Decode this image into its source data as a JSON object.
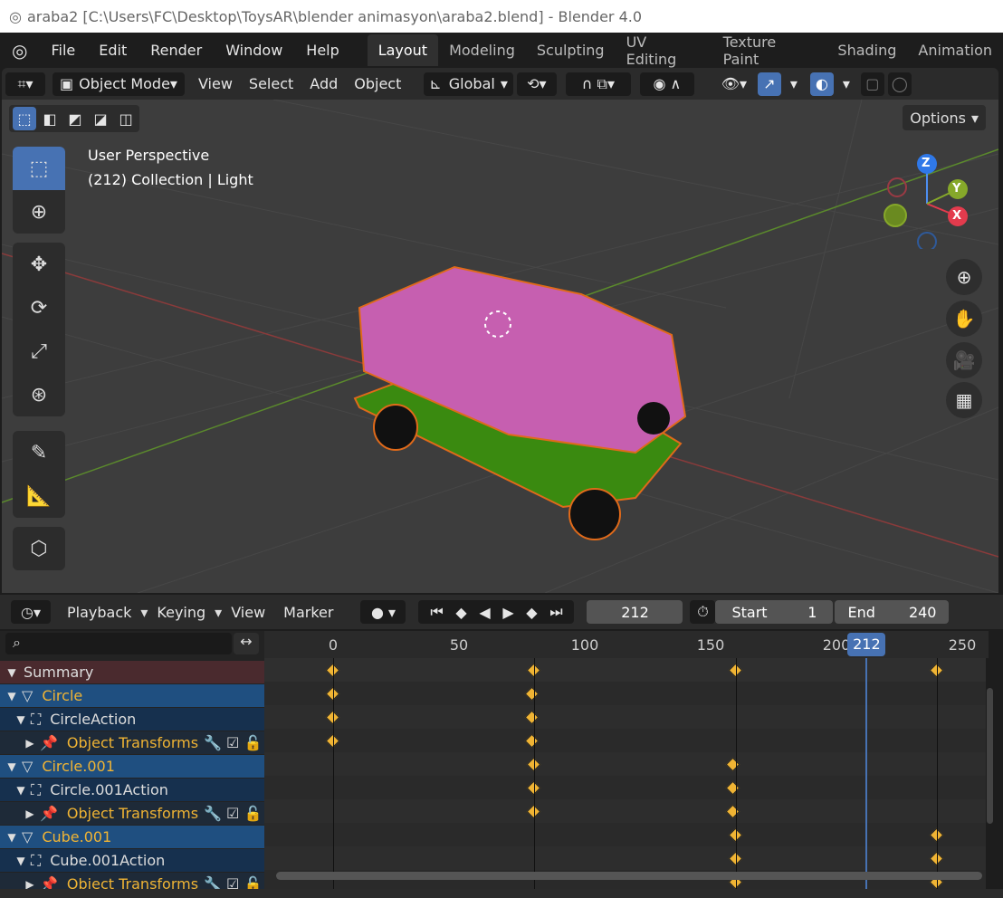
{
  "window": {
    "title": "araba2 [C:\\Users\\FC\\Desktop\\ToysAR\\blender animasyon\\araba2.blend] - Blender 4.0"
  },
  "menu": {
    "file": "File",
    "edit": "Edit",
    "render": "Render",
    "window": "Window",
    "help": "Help"
  },
  "workspaces": [
    "Layout",
    "Modeling",
    "Sculpting",
    "UV Editing",
    "Texture Paint",
    "Shading",
    "Animation"
  ],
  "viewport_header": {
    "mode": "Object Mode",
    "view": "View",
    "select": "Select",
    "add": "Add",
    "object": "Object",
    "orientation": "Global",
    "options": "Options"
  },
  "viewport": {
    "perspective": "User Perspective",
    "collection": "(212) Collection | Light"
  },
  "gizmo": {
    "z": "Z",
    "y": "Y",
    "x": "X"
  },
  "timeline_header": {
    "playback": "Playback",
    "keying": "Keying",
    "view": "View",
    "marker": "Marker",
    "current_frame": "212",
    "start_label": "Start",
    "start_value": "1",
    "end_label": "End",
    "end_value": "240"
  },
  "ruler": {
    "ticks": [
      "0",
      "50",
      "100",
      "150",
      "200",
      "250"
    ],
    "current": "212"
  },
  "channels": [
    {
      "label": "Summary",
      "type": "summary"
    },
    {
      "label": "Circle",
      "type": "object"
    },
    {
      "label": "CircleAction",
      "type": "action"
    },
    {
      "label": "Object Transforms",
      "type": "group"
    },
    {
      "label": "Circle.001",
      "type": "object"
    },
    {
      "label": "Circle.001Action",
      "type": "action"
    },
    {
      "label": "Object Transforms",
      "type": "group"
    },
    {
      "label": "Cube.001",
      "type": "object"
    },
    {
      "label": "Cube.001Action",
      "type": "action"
    },
    {
      "label": "Object Transforms",
      "type": "group"
    }
  ],
  "keyframes": [
    [
      0,
      80,
      160,
      240
    ],
    [
      0,
      79
    ],
    [
      0,
      79
    ],
    [
      0,
      79
    ],
    [
      80,
      159
    ],
    [
      80,
      159
    ],
    [
      80,
      159
    ],
    [
      160,
      240
    ],
    [
      160,
      240
    ],
    [
      160,
      240
    ]
  ],
  "colors": {
    "accent": "#4772b3",
    "keyframe": "#f0b434",
    "object_row": "#1f4f80",
    "summary_row": "#4a2a2e"
  }
}
